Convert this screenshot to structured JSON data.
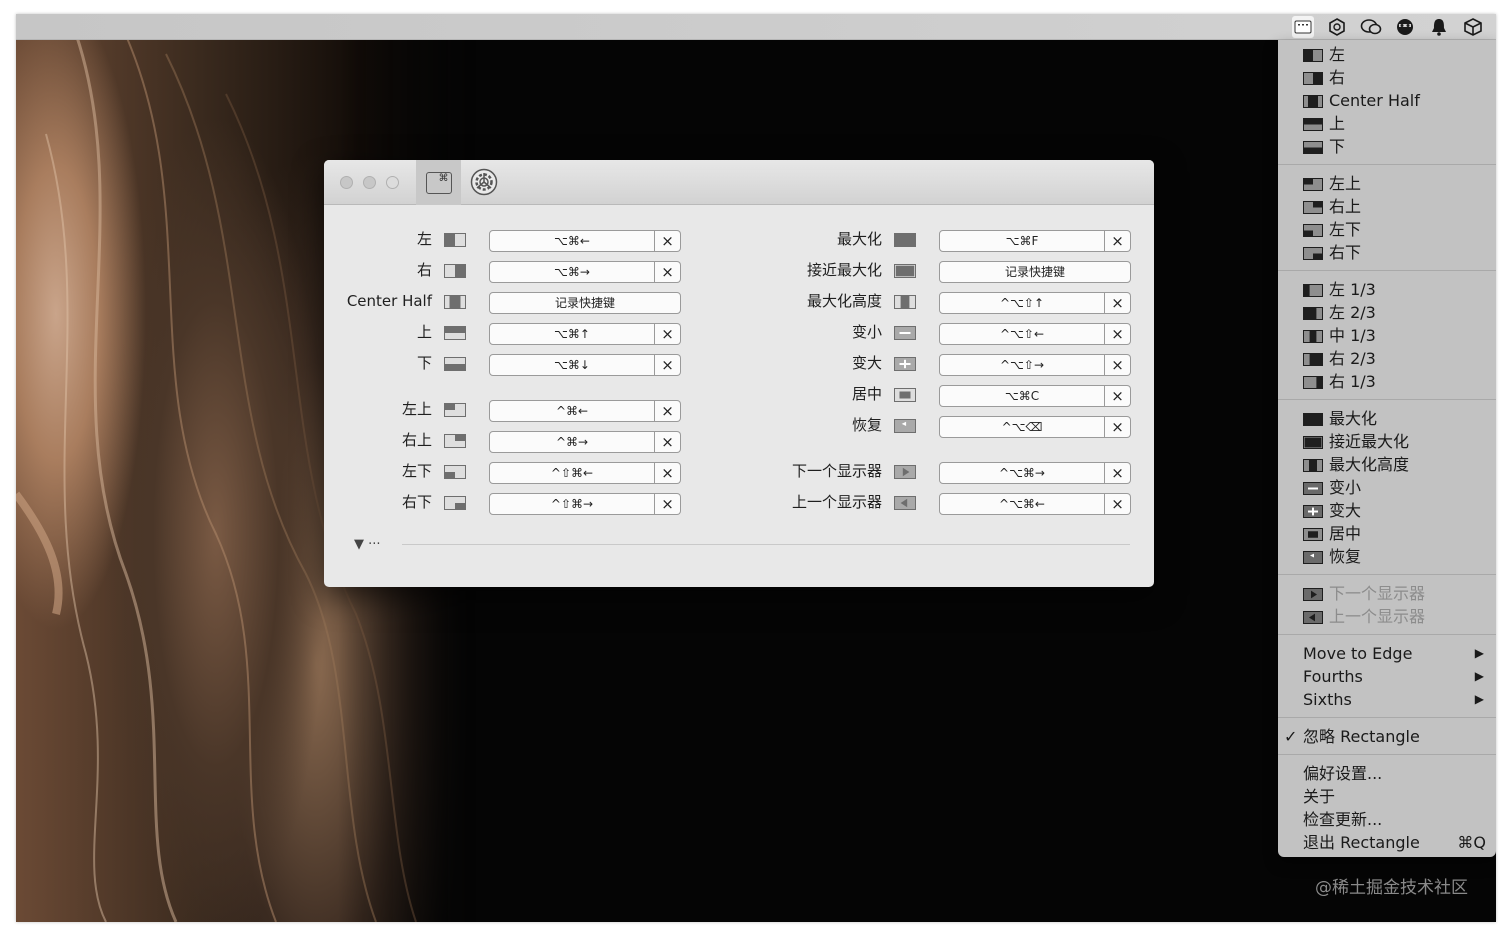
{
  "menubar": {
    "status_icons": [
      "shortcut-keyboard-icon",
      "hexagon-icon",
      "chat-bubbles-icon",
      "face-icon",
      "bell-icon",
      "box-icon"
    ]
  },
  "menu": {
    "group1": [
      {
        "label": "左",
        "icon": "half-left-icon"
      },
      {
        "label": "右",
        "icon": "half-right-icon"
      },
      {
        "label": "Center Half",
        "icon": "center-half-icon"
      },
      {
        "label": "上",
        "icon": "half-top-icon"
      },
      {
        "label": "下",
        "icon": "half-bottom-icon"
      }
    ],
    "group2": [
      {
        "label": "左上",
        "icon": "top-left-icon"
      },
      {
        "label": "右上",
        "icon": "top-right-icon"
      },
      {
        "label": "左下",
        "icon": "bottom-left-icon"
      },
      {
        "label": "右下",
        "icon": "bottom-right-icon"
      }
    ],
    "group3": [
      {
        "label": "左 1/3",
        "icon": "first-third-icon"
      },
      {
        "label": "左 2/3",
        "icon": "first-two-thirds-icon"
      },
      {
        "label": "中 1/3",
        "icon": "center-third-icon"
      },
      {
        "label": "右 2/3",
        "icon": "last-two-thirds-icon"
      },
      {
        "label": "右 1/3",
        "icon": "last-third-icon"
      }
    ],
    "group4": [
      {
        "label": "最大化",
        "icon": "maximize-icon"
      },
      {
        "label": "接近最大化",
        "icon": "almost-maximize-icon"
      },
      {
        "label": "最大化高度",
        "icon": "maximize-height-icon"
      },
      {
        "label": "变小",
        "icon": "smaller-icon"
      },
      {
        "label": "变大",
        "icon": "larger-icon"
      },
      {
        "label": "居中",
        "icon": "center-icon"
      },
      {
        "label": "恢复",
        "icon": "restore-icon"
      }
    ],
    "group5": [
      {
        "label": "下一个显示器",
        "icon": "next-display-icon"
      },
      {
        "label": "上一个显示器",
        "icon": "previous-display-icon"
      }
    ],
    "submenus": [
      "Move to Edge",
      "Fourths",
      "Sixths"
    ],
    "ignore": "忽略 Rectangle",
    "ignore_check": "✓",
    "prefs": "偏好设置...",
    "about": "关于",
    "updates": "检查更新...",
    "quit": "退出 Rectangle",
    "quit_shortcut": "⌘Q"
  },
  "window": {
    "toolbar": {
      "shortcuts_tab_glyph": "⌘"
    },
    "left_rows": [
      {
        "label": "左",
        "icon": "half-left-icon",
        "shortcut": "⌥⌘←"
      },
      {
        "label": "右",
        "icon": "half-right-icon",
        "shortcut": "⌥⌘→"
      },
      {
        "label": "Center Half",
        "icon": "center-half-icon",
        "shortcut": "记录快捷键"
      },
      {
        "label": "上",
        "icon": "half-top-icon",
        "shortcut": "⌥⌘↑"
      },
      {
        "label": "下",
        "icon": "half-bottom-icon",
        "shortcut": "⌥⌘↓"
      },
      {
        "label": "左上",
        "icon": "top-left-icon",
        "shortcut": "^⌘←"
      },
      {
        "label": "右上",
        "icon": "top-right-icon",
        "shortcut": "^⌘→"
      },
      {
        "label": "左下",
        "icon": "bottom-left-icon",
        "shortcut": "^⇧⌘←"
      },
      {
        "label": "右下",
        "icon": "bottom-right-icon",
        "shortcut": "^⇧⌘→"
      }
    ],
    "right_rows": [
      {
        "label": "最大化",
        "icon": "maximize-icon",
        "shortcut": "⌥⌘F"
      },
      {
        "label": "接近最大化",
        "icon": "almost-maximize-icon",
        "shortcut": "记录快捷键"
      },
      {
        "label": "最大化高度",
        "icon": "maximize-height-icon",
        "shortcut": "^⌥⇧↑"
      },
      {
        "label": "变小",
        "icon": "smaller-icon",
        "shortcut": "^⌥⇧←"
      },
      {
        "label": "变大",
        "icon": "larger-icon",
        "shortcut": "^⌥⇧→"
      },
      {
        "label": "居中",
        "icon": "center-icon",
        "shortcut": "⌥⌘C"
      },
      {
        "label": "恢复",
        "icon": "restore-icon",
        "shortcut": "^⌥⌫"
      },
      {
        "label": "下一个显示器",
        "icon": "next-display-icon",
        "shortcut": "^⌥⌘→"
      },
      {
        "label": "上一个显示器",
        "icon": "previous-display-icon",
        "shortcut": "^⌥⌘←"
      }
    ],
    "clear_glyph": "×",
    "disclosure": "▼ ···"
  },
  "watermark": "@稀土掘金技术社区",
  "colors": {
    "menu_bg": "#c2c2c2",
    "window_bg": "#e8e8e8",
    "desktop_bg": "#050505"
  }
}
